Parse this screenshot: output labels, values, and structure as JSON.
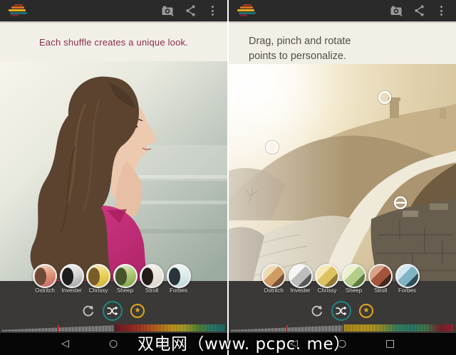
{
  "topbar": {
    "icons": {
      "camera": "camera-icon",
      "share": "share-icon",
      "overflow": "overflow-menu-icon"
    }
  },
  "panel_left": {
    "heading": "Each shuffle creates a unique look."
  },
  "panel_right": {
    "heading_line1": "Drag, pinch and rotate",
    "heading_line2": "points to personalize.",
    "marker_count": 3
  },
  "filters": [
    {
      "label": "Ostritch"
    },
    {
      "label": "Invester"
    },
    {
      "label": "Chrissy"
    },
    {
      "label": "Sheep"
    },
    {
      "label": "Stroll"
    },
    {
      "label": "Forbes"
    }
  ],
  "icons": {
    "undo": "undo-icon",
    "shuffle": "shuffle-icon",
    "favorite": "★",
    "nav_back": "◁",
    "nav_home": "○",
    "nav_recents": "□"
  },
  "palette": {
    "left": [
      "#7e1722",
      "#c23a28",
      "#dd7722",
      "#e7b322",
      "#c9bd2c",
      "#5d9c3c",
      "#2f9080",
      "#1f7a76"
    ],
    "right": [
      "#c9a11f",
      "#e0b823",
      "#bfae2a",
      "#3f9a6d",
      "#2d8f82",
      "#4a8f55",
      "#8c2430",
      "#b32736"
    ],
    "tick_color": "#c03030"
  },
  "colors": {
    "topbar": "#2a2a2a",
    "panel_bg": "#f2efe7",
    "controls_bg": "#3b3937",
    "navbar": "#060606",
    "accent_teal": "#1d8583",
    "accent_gold": "#e2a71c",
    "heading_maroon": "#8c2f47",
    "heading_gray": "#514e46",
    "divider": "#ffffff"
  },
  "watermark": {
    "text": "双电网（www. pcpc. me）"
  }
}
